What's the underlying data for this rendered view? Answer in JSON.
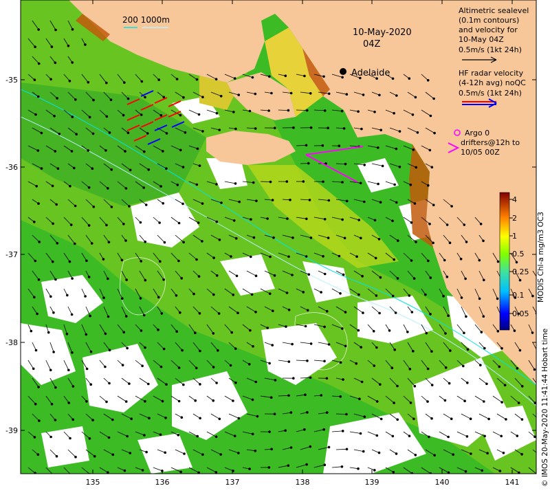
{
  "map": {
    "date_title": "10-May-2020",
    "time_title": "04Z",
    "city_label": "Adelaide",
    "depth_contour_label": "200  1000m",
    "colorbar_label": "MODIS Chl-a mg/m3 OC3",
    "credit": "© IMOS 20-May-2020 11:41:44 Hobart time",
    "colors": {
      "land": "#f7c79a",
      "ocean_low": "#33bb22",
      "ocean_high": "#9ed21a",
      "coastal_high": "#c25a0c",
      "arrow": "#000000",
      "radar_red": "#ff0000",
      "radar_blue": "#0000ff",
      "argo_drifter": "#ff00ff",
      "contour_200m": "#00e5e5"
    }
  },
  "legend": {
    "altimetry_lines": [
      "Altimetric sealevel",
      "(0.1m contours)",
      "and velocity for",
      "10-May 04Z",
      "0.5m/s (1kt 24h)"
    ],
    "radar_lines": [
      "HF radar velocity",
      "(4-12h avg) noQC",
      "0.5m/s (1kt 24h)"
    ],
    "argo_lines": [
      "Argo 0",
      "drifters@12h to",
      "10/05 00Z"
    ]
  },
  "axes": {
    "x_ticks": [
      "135",
      "136",
      "137",
      "138",
      "139",
      "140",
      "141"
    ],
    "y_ticks": [
      "-35",
      "-36",
      "-37",
      "-38",
      "-39"
    ],
    "colorbar_ticks": [
      "4",
      "2",
      "1",
      "0.5",
      "0.25",
      "0.1",
      "0.05"
    ]
  }
}
